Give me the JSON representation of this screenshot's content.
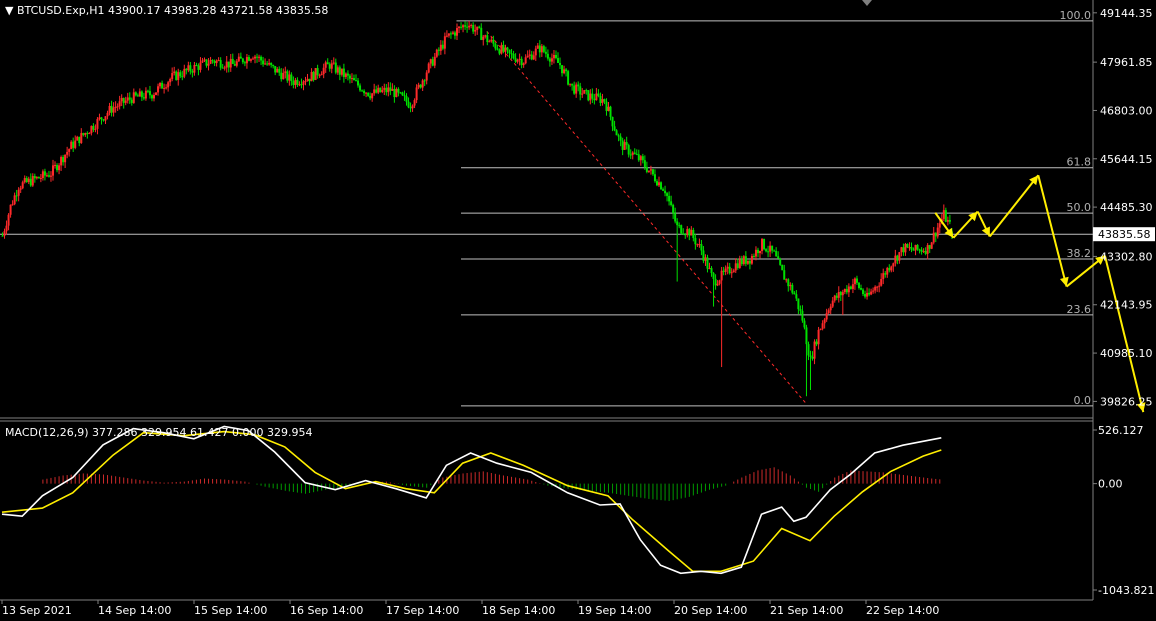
{
  "header": {
    "symbol": "BTCUSD.Exp,H1",
    "ohlc": "43900.17 43983.28 43721.58 43835.58",
    "macd_label": "MACD(12,26,9) 377.286 329.954 61.427 0.000 329.954"
  },
  "colors": {
    "background": "#000000",
    "bull": "#ff2a2a",
    "bear": "#00e000",
    "fib": "#c0c0c0",
    "trend": "#ff2a2a",
    "forecast": "#ffee00",
    "macd_main": "#ffffff",
    "macd_signal": "#ffee00",
    "hist_pos": "#cc2a2a",
    "hist_neg": "#009a00"
  },
  "chart_data": [
    {
      "type": "candlestick",
      "title": "",
      "x_labels": [
        "13 Sep 2021",
        "14 Sep 14:00",
        "15 Sep 14:00",
        "16 Sep 14:00",
        "17 Sep 14:00",
        "18 Sep 14:00",
        "19 Sep 14:00",
        "20 Sep 14:00",
        "21 Sep 14:00",
        "22 Sep 14:00"
      ],
      "y_ticks": [
        "49144.35",
        "47961.85",
        "46803.00",
        "45644.15",
        "44485.30",
        "43302.80",
        "42143.95",
        "40985.10",
        "39826.25"
      ],
      "ylim": [
        39620,
        49260
      ],
      "current_price": "43835.58",
      "price_path": [
        [
          0,
          43800
        ],
        [
          4,
          44500
        ],
        [
          8,
          45000
        ],
        [
          16,
          45150
        ],
        [
          24,
          45300
        ],
        [
          34,
          45950
        ],
        [
          44,
          46400
        ],
        [
          54,
          46850
        ],
        [
          64,
          47100
        ],
        [
          74,
          47200
        ],
        [
          84,
          47600
        ],
        [
          96,
          47850
        ],
        [
          104,
          48000
        ],
        [
          114,
          47900
        ],
        [
          124,
          48150
        ],
        [
          134,
          47800
        ],
        [
          144,
          47500
        ],
        [
          152,
          47600
        ],
        [
          162,
          47900
        ],
        [
          172,
          47550
        ],
        [
          182,
          47200
        ],
        [
          192,
          47300
        ],
        [
          202,
          46950
        ],
        [
          210,
          47750
        ],
        [
          220,
          48550
        ],
        [
          230,
          48900
        ],
        [
          240,
          48500
        ],
        [
          250,
          48150
        ],
        [
          258,
          48000
        ],
        [
          266,
          48300
        ],
        [
          276,
          47900
        ],
        [
          282,
          47350
        ],
        [
          290,
          47150
        ],
        [
          298,
          47050
        ],
        [
          306,
          46000
        ],
        [
          316,
          45600
        ],
        [
          322,
          45250
        ],
        [
          328,
          44900
        ],
        [
          334,
          44000
        ],
        [
          340,
          43900
        ],
        [
          346,
          43450
        ],
        [
          352,
          42700
        ],
        [
          358,
          42900
        ],
        [
          364,
          43150
        ],
        [
          370,
          43250
        ],
        [
          376,
          43600
        ],
        [
          382,
          43350
        ],
        [
          386,
          42900
        ],
        [
          392,
          42400
        ],
        [
          396,
          41800
        ],
        [
          400,
          40800
        ],
        [
          404,
          41500
        ],
        [
          410,
          42200
        ],
        [
          416,
          42450
        ],
        [
          422,
          42700
        ],
        [
          428,
          42300
        ],
        [
          434,
          42700
        ],
        [
          440,
          43150
        ],
        [
          446,
          43500
        ],
        [
          452,
          43450
        ],
        [
          458,
          43500
        ],
        [
          462,
          43900
        ],
        [
          466,
          44300
        ],
        [
          470,
          43950
        ]
      ],
      "spikes": [
        {
          "bar": 356,
          "low": 40650
        },
        {
          "bar": 352,
          "low": 42100
        },
        {
          "bar": 334,
          "low": 42700
        },
        {
          "bar": 398,
          "low": 39950
        },
        {
          "bar": 400,
          "low": 40100
        },
        {
          "bar": 416,
          "low": 41900
        }
      ],
      "fibonacci": {
        "high": 48950,
        "low": 39720,
        "levels": [
          {
            "label": "100.0",
            "price": 48950
          },
          {
            "label": "61.8",
            "price": 45430
          },
          {
            "label": "50.0",
            "price": 44340
          },
          {
            "label": "38.2",
            "price": 43240
          },
          {
            "label": "23.6",
            "price": 41900
          },
          {
            "label": "0.0",
            "price": 39720
          }
        ]
      },
      "trendline": {
        "from": {
          "bar": 240,
          "price": 48700
        },
        "to": {
          "bar": 398,
          "price": 39780
        }
      },
      "forecast_path": [
        {
          "bar": 462,
          "price": 44350
        },
        {
          "bar": 471,
          "price": 43750
        },
        {
          "bar": 483,
          "price": 44380
        },
        {
          "bar": 489,
          "price": 43780
        },
        {
          "bar": 513,
          "price": 45250
        },
        {
          "bar": 527,
          "price": 42580
        },
        {
          "bar": 546,
          "price": 43320
        },
        {
          "bar": 565,
          "price": 39570
        }
      ]
    },
    {
      "type": "macd",
      "title": "",
      "y_ticks": [
        "526.127",
        "0.00",
        "-1043.821"
      ],
      "ylim": [
        -1043.821,
        526.127
      ],
      "main_series": [
        [
          0,
          -300
        ],
        [
          10,
          -320
        ],
        [
          20,
          -120
        ],
        [
          35,
          60
        ],
        [
          50,
          380
        ],
        [
          65,
          540
        ],
        [
          80,
          500
        ],
        [
          95,
          440
        ],
        [
          110,
          560
        ],
        [
          122,
          520
        ],
        [
          135,
          310
        ],
        [
          150,
          10
        ],
        [
          165,
          -60
        ],
        [
          180,
          30
        ],
        [
          195,
          -50
        ],
        [
          210,
          -140
        ],
        [
          220,
          180
        ],
        [
          232,
          300
        ],
        [
          245,
          200
        ],
        [
          262,
          110
        ],
        [
          280,
          -90
        ],
        [
          296,
          -210
        ],
        [
          306,
          -200
        ],
        [
          316,
          -550
        ],
        [
          326,
          -800
        ],
        [
          336,
          -880
        ],
        [
          346,
          -860
        ],
        [
          356,
          -880
        ],
        [
          366,
          -820
        ],
        [
          376,
          -300
        ],
        [
          386,
          -230
        ],
        [
          392,
          -370
        ],
        [
          398,
          -330
        ],
        [
          410,
          -60
        ],
        [
          420,
          90
        ],
        [
          432,
          300
        ],
        [
          446,
          377
        ],
        [
          465,
          450
        ]
      ],
      "signal_series": [
        [
          0,
          -280
        ],
        [
          20,
          -240
        ],
        [
          35,
          -90
        ],
        [
          55,
          280
        ],
        [
          70,
          500
        ],
        [
          90,
          470
        ],
        [
          110,
          510
        ],
        [
          125,
          480
        ],
        [
          140,
          360
        ],
        [
          155,
          110
        ],
        [
          170,
          -50
        ],
        [
          185,
          20
        ],
        [
          200,
          -50
        ],
        [
          214,
          -90
        ],
        [
          228,
          200
        ],
        [
          242,
          300
        ],
        [
          258,
          180
        ],
        [
          280,
          -20
        ],
        [
          300,
          -120
        ],
        [
          312,
          -350
        ],
        [
          330,
          -660
        ],
        [
          342,
          -860
        ],
        [
          356,
          -860
        ],
        [
          372,
          -760
        ],
        [
          386,
          -440
        ],
        [
          400,
          -560
        ],
        [
          412,
          -320
        ],
        [
          426,
          -80
        ],
        [
          440,
          120
        ],
        [
          456,
          270
        ],
        [
          465,
          330
        ]
      ],
      "histogram": [
        [
          20,
          40
        ],
        [
          30,
          80
        ],
        [
          40,
          100
        ],
        [
          50,
          90
        ],
        [
          60,
          60
        ],
        [
          70,
          30
        ],
        [
          80,
          10
        ],
        [
          90,
          20
        ],
        [
          100,
          50
        ],
        [
          110,
          40
        ],
        [
          120,
          20
        ],
        [
          130,
          -30
        ],
        [
          140,
          -70
        ],
        [
          150,
          -100
        ],
        [
          160,
          -60
        ],
        [
          170,
          -30
        ],
        [
          180,
          10
        ],
        [
          190,
          20
        ],
        [
          200,
          -20
        ],
        [
          210,
          -40
        ],
        [
          218,
          60
        ],
        [
          228,
          100
        ],
        [
          238,
          120
        ],
        [
          248,
          80
        ],
        [
          260,
          40
        ],
        [
          270,
          -20
        ],
        [
          280,
          -50
        ],
        [
          290,
          -70
        ],
        [
          300,
          -90
        ],
        [
          310,
          -120
        ],
        [
          320,
          -150
        ],
        [
          330,
          -170
        ],
        [
          340,
          -130
        ],
        [
          350,
          -60
        ],
        [
          358,
          -20
        ],
        [
          366,
          60
        ],
        [
          374,
          130
        ],
        [
          382,
          160
        ],
        [
          390,
          80
        ],
        [
          398,
          -40
        ],
        [
          404,
          -80
        ],
        [
          412,
          60
        ],
        [
          420,
          130
        ],
        [
          428,
          120
        ],
        [
          436,
          110
        ],
        [
          444,
          90
        ],
        [
          452,
          70
        ],
        [
          460,
          50
        ],
        [
          465,
          40
        ]
      ]
    }
  ]
}
